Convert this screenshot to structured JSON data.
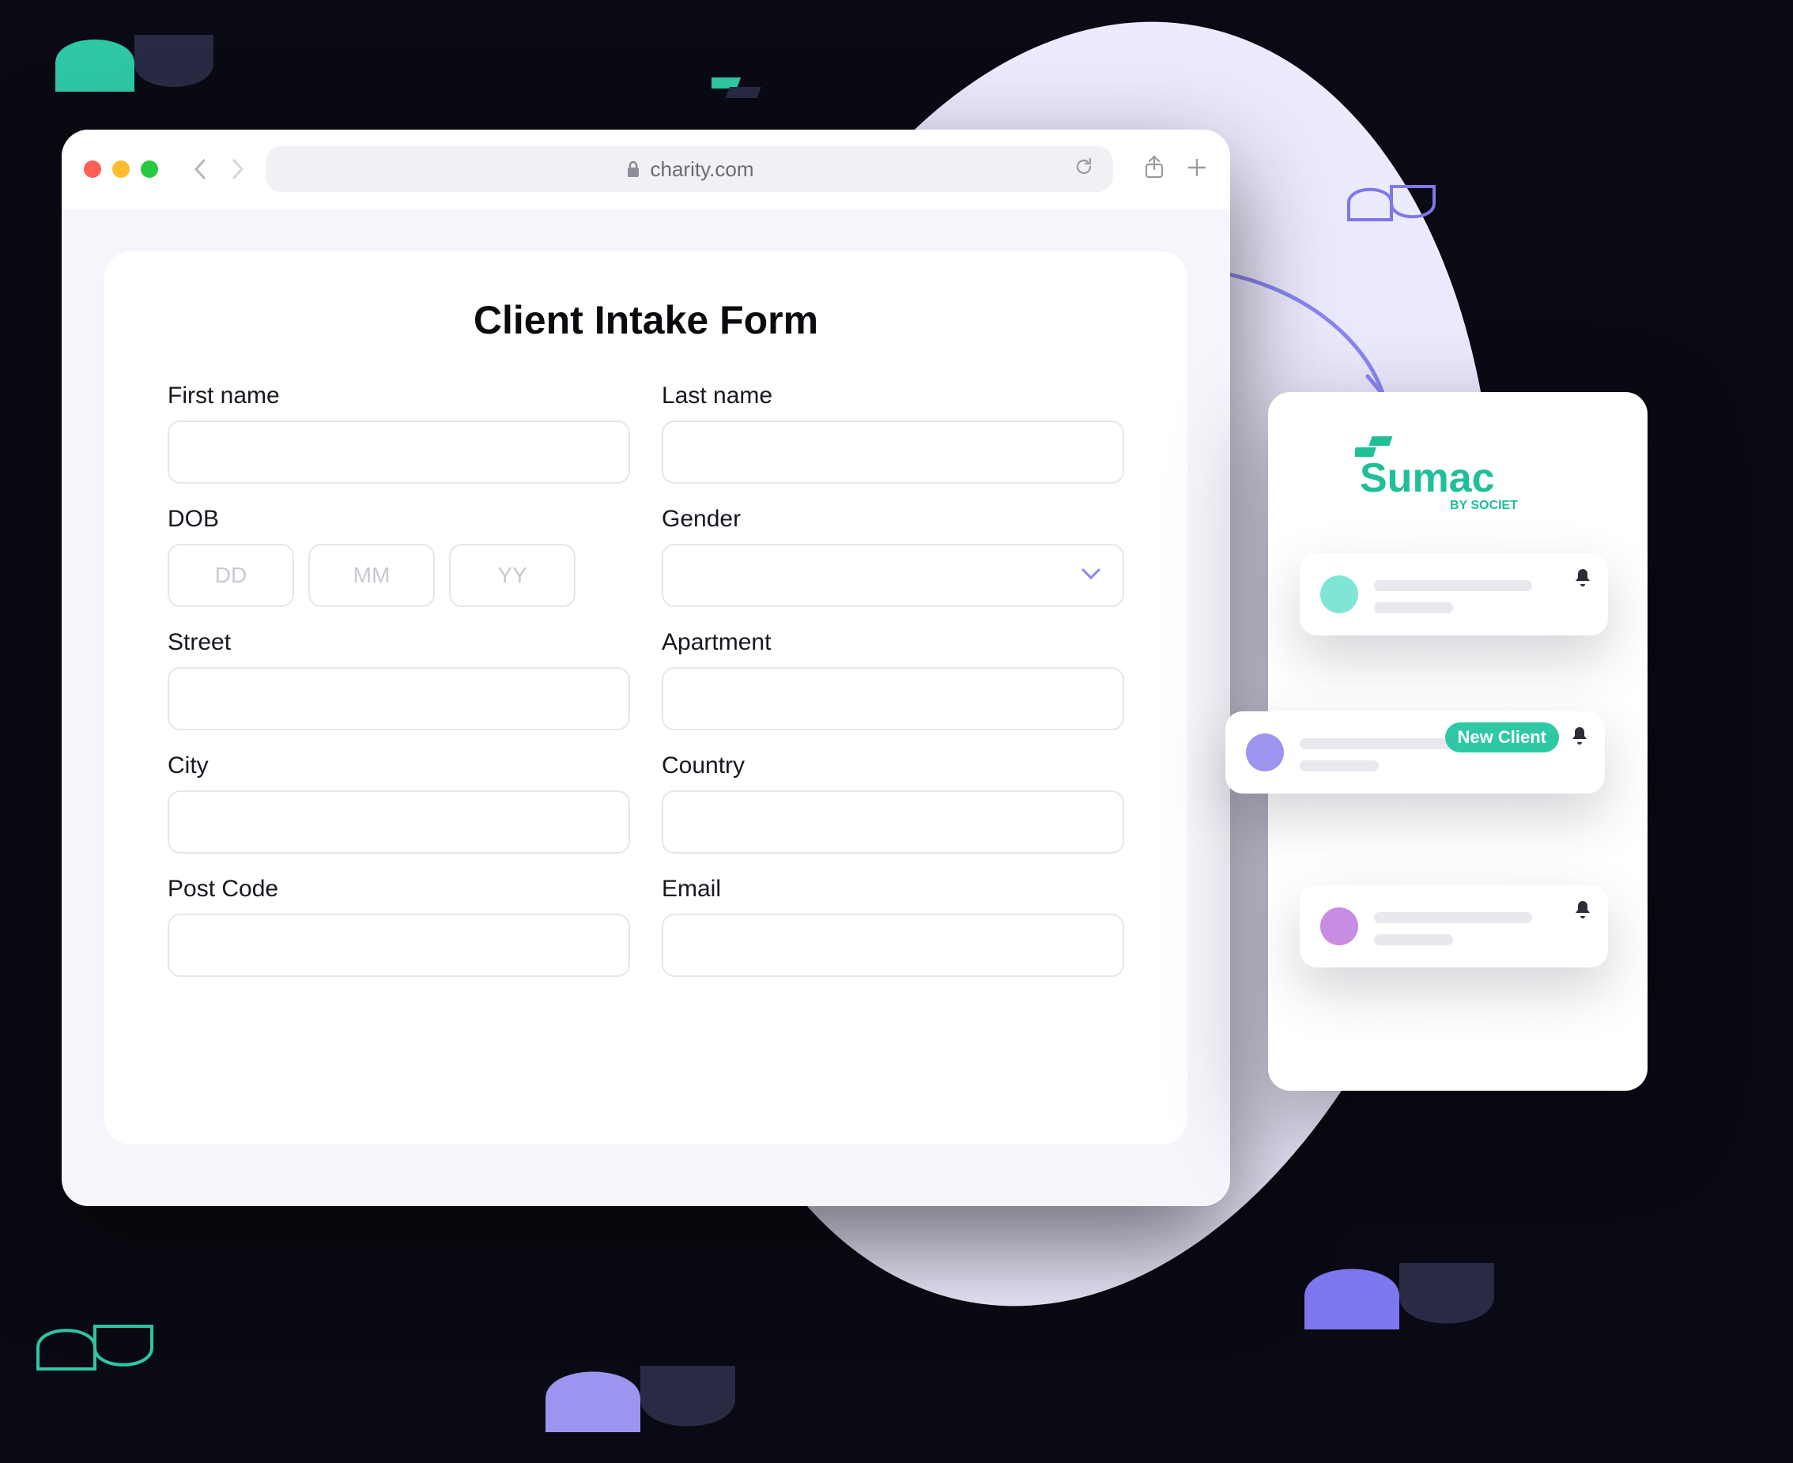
{
  "browser": {
    "url_display": "charity.com"
  },
  "form": {
    "title": "Client Intake Form",
    "first_name_label": "First name",
    "last_name_label": "Last name",
    "dob_label": "DOB",
    "dob_dd_placeholder": "DD",
    "dob_mm_placeholder": "MM",
    "dob_yy_placeholder": "YY",
    "gender_label": "Gender",
    "street_label": "Street",
    "apartment_label": "Apartment",
    "city_label": "City",
    "country_label": "Country",
    "postcode_label": "Post Code",
    "email_label": "Email"
  },
  "panel": {
    "logo_text": "Sumac",
    "logo_subtext": "BY SOCIET",
    "logo_color": "#1FBF99",
    "notifications": {
      "new_client_badge": "New Client"
    }
  }
}
